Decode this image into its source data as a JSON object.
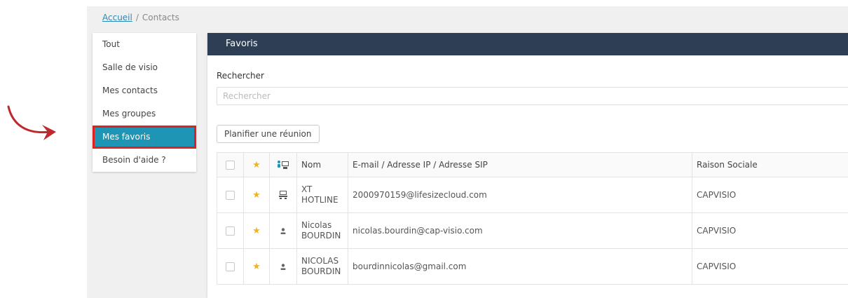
{
  "breadcrumb": {
    "home": "Accueil",
    "separator": "/",
    "current": "Contacts"
  },
  "menu": {
    "items": [
      {
        "label": "Tout"
      },
      {
        "label": "Salle de visio"
      },
      {
        "label": "Mes contacts"
      },
      {
        "label": "Mes groupes"
      },
      {
        "label": "Mes favoris",
        "active": true
      },
      {
        "label": "Besoin d'aide ?"
      }
    ]
  },
  "panel": {
    "title": "Favoris",
    "search_label": "Rechercher",
    "search_placeholder": "Rechercher",
    "search_value": "",
    "plan_button": "Planifier une réunion"
  },
  "table": {
    "headers": {
      "name": "Nom",
      "email": "E-mail / Adresse IP / Adresse SIP",
      "company": "Raison Sociale"
    },
    "rows": [
      {
        "type": "room-icon",
        "name_line1": "XT",
        "name_line2": "HOTLINE",
        "email": "2000970159@lifesizecloud.com",
        "company": "CAPVISIO"
      },
      {
        "type": "user-icon",
        "name_line1": "Nicolas",
        "name_line2": "BOURDIN",
        "email": "nicolas.bourdin@cap-visio.com",
        "company": "CAPVISIO"
      },
      {
        "type": "user-icon",
        "name_line1": "NICOLAS",
        "name_line2": "BOURDIN",
        "email": "bourdinnicolas@gmail.com",
        "company": "CAPVISIO"
      }
    ]
  },
  "colors": {
    "accent": "#1f95b5",
    "header": "#2e3f55",
    "highlight": "#e02020",
    "star": "#f3b21d",
    "link": "#2a88b8"
  }
}
